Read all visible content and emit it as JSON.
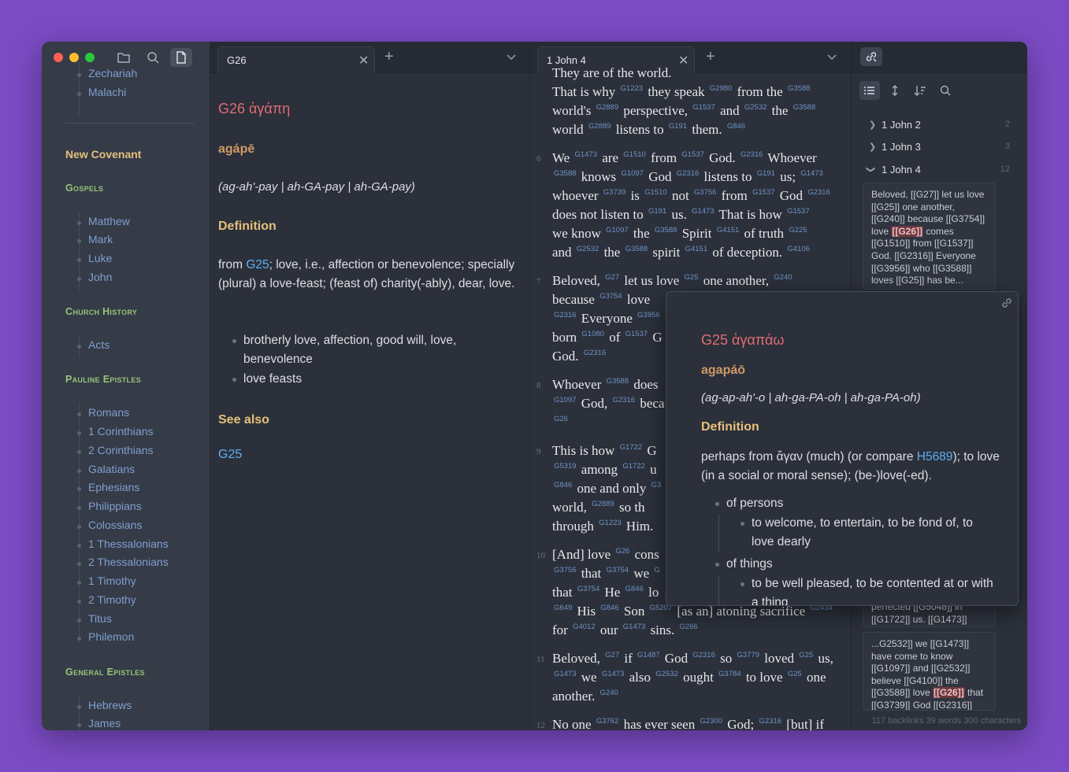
{
  "sidebar": {
    "books_top": [
      "Zechariah",
      "Malachi"
    ],
    "covenant": "New Covenant",
    "sections": [
      {
        "title": "Gospels",
        "books": [
          "Matthew",
          "Mark",
          "Luke",
          "John"
        ]
      },
      {
        "title": "Church History",
        "books": [
          "Acts"
        ]
      },
      {
        "title": "Pauline Epistles",
        "books": [
          "Romans",
          "1 Corinthians",
          "2 Corinthians",
          "Galatians",
          "Ephesians",
          "Philippians",
          "Colossians",
          "1 Thessalonians",
          "2 Thessalonians",
          "1 Timothy",
          "2 Timothy",
          "Titus",
          "Philemon"
        ]
      },
      {
        "title": "General Epistles",
        "books": [
          "Hebrews",
          "James"
        ]
      }
    ]
  },
  "pane1": {
    "tab": "G26",
    "title": "G26 ἀγάπη",
    "translit": "agápē",
    "pron": "(ag-ah'-pay | ah-GA-pay | ah-GA-pay)",
    "def_heading": "Definition",
    "def_from": "from ",
    "def_link": "G25",
    "def_rest": "; love, i.e., affection or benevolence; specially (plural) a love-feast; (feast of) charity(-ably), dear, love.",
    "items": [
      "brotherly love, affection, good will, love, benevolence",
      "love feasts"
    ],
    "see_also": "See also",
    "see_link": "G25"
  },
  "pane2": {
    "tab": "1 John 4",
    "lines": [
      {
        "t": "They are of the world."
      },
      {
        "t": "That is why <s>G1223</s> they speak <s>G2980</s> from the <s>G3588</s>"
      },
      {
        "t": "world's <s>G2889</s> perspective, <s>G1537</s> and <s>G2532</s> the <s>G3588</s>"
      },
      {
        "t": "world <s>G2889</s> listens to <s>G191</s> them. <s>G846</s>"
      },
      {
        "n": "6",
        "t": "We <s>G1473</s> are <s>G1510</s> from <s>G1537</s> God. <s>G2316</s> Whoever"
      },
      {
        "t": "<s>G3588</s> knows <s>G1097</s> God <s>G2316</s> listens to <s>G191</s> us; <s>G1473</s>"
      },
      {
        "t": "whoever <s>G3739</s> is <s>G1510</s> not <s>G3756</s> from <s>G1537</s> God <s>G2316</s>"
      },
      {
        "t": "does not listen to <s>G191</s> us. <s>G1473</s> That is how <s>G1537</s>"
      },
      {
        "t": "we know <s>G1097</s> the <s>G3588</s> Spirit <s>G4151</s> of truth <s>G225</s>"
      },
      {
        "t": "and <s>G2532</s> the <s>G3588</s> spirit <s>G4151</s> of deception. <s>G4106</s>"
      },
      {
        "n": "7",
        "t": "Beloved, <s>G27</s> let us love <s>G25</s> one another, <s>G240</s>"
      },
      {
        "t": "because <s>G3754</s> love"
      },
      {
        "t": "<s>G2316</s> Everyone <s>G3956</s>"
      },
      {
        "t": "born <s>G1080</s> of <s>G1537</s> G"
      },
      {
        "t": "God. <s>G2316</s>"
      },
      {
        "n": "8",
        "t": "Whoever <s>G3588</s> does"
      },
      {
        "t": "<s>G1097</s> God, <s>G2316</s> beca"
      },
      {
        "t": "<s>G26</s>"
      },
      {
        "n": "9",
        "t": "This is how <s>G1722</s> G"
      },
      {
        "t": "<s>G5319</s> among <s>G1722</s> u"
      },
      {
        "t": "<s>G846</s> one and only <s>G3</s>"
      },
      {
        "t": "world, <s>G2889</s> so th"
      },
      {
        "t": "through <s>G1223</s> Him. "
      },
      {
        "n": "10",
        "t": "[And] love <s>G26</s> cons"
      },
      {
        "t": "<s>G3756</s> that <s>G3754</s> we <s>G</s>"
      },
      {
        "t": "that <s>G3754</s> He <s>G846</s> lo"
      },
      {
        "t": "<s>G649</s> His <s>G846</s> Son <s>G5207</s> [as an] atoning sacrifice <s>G2434</s>"
      },
      {
        "t": "for <s>G4012</s> our <s>G1473</s> sins. <s>G266</s>"
      },
      {
        "n": "11",
        "t": "Beloved, <s>G27</s> if <s>G1487</s> God <s>G2316</s> so <s>G3779</s> loved <s>G25</s> us,"
      },
      {
        "t": "<s>G1473</s> we <s>G1473</s> also <s>G2532</s> ought <s>G3784</s> to love <s>G25</s> one"
      },
      {
        "t": "another. <s>G240</s>"
      },
      {
        "n": "12",
        "t": "No one <s>G3762</s> has ever seen <s>G2300</s> God; <s>G2316</s> [but] if"
      }
    ]
  },
  "pane3": {
    "files": [
      {
        "name": "1 John 2",
        "count": "2",
        "open": false
      },
      {
        "name": "1 John 3",
        "count": "3",
        "open": false
      },
      {
        "name": "1 John 4",
        "count": "12",
        "open": true
      }
    ],
    "card1_pre": "Beloved, [[G27]] let us love [[G25]] one another, [[G240]] because [[G3754]] love ",
    "card1_hl": "[[G26]]",
    "card1_post": " comes [[G1510]] from [[G1537]] God. [[G2316]] Everyone [[G3956]] who [[G3588]] loves [[G25]] has be...",
    "card2_text": "perfected [[G5048]] in [[G1722]] us. [[G1473]]",
    "card3_pre": "...G2532]] we [[G1473]] have come to know [[G1097]] and [[G2532]] believe [[G4100]] the [[G3588]] love ",
    "card3_hl": "[[G26]]",
    "card3_post": " that [[G3739]] God [[G2316]]",
    "status": "117 backlinks   39 words   300 characters"
  },
  "popover": {
    "title": "G25 ἀγαπάω",
    "translit": "agapáō",
    "pron": "(ag-ap-ah'-o | ah-ga-PA-oh | ah-ga-PA-oh)",
    "def_heading": "Definition",
    "def_pre": "perhaps from ἄγαν (much) (or compare ",
    "def_link": "H5689",
    "def_post": "); to love (in a social or moral sense); (be-)love(-ed).",
    "item1": "of persons",
    "item1_sub": "to welcome, to entertain, to be fond of, to love dearly",
    "item2": "of things",
    "item2_sub": "to be well pleased, to be contented at or with a thing"
  }
}
